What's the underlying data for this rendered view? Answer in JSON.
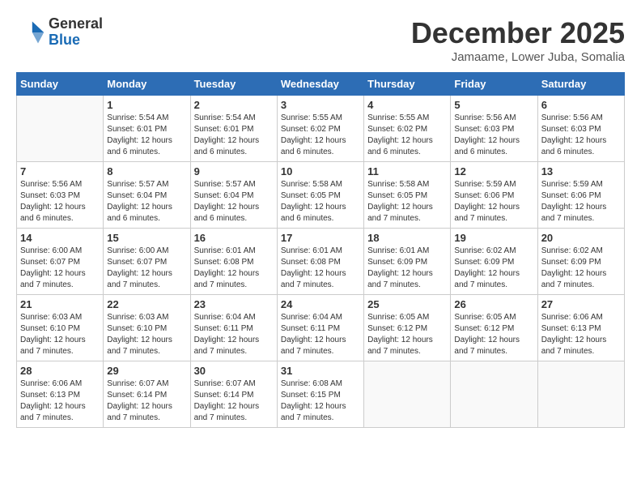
{
  "logo": {
    "line1": "General",
    "line2": "Blue"
  },
  "title": "December 2025",
  "subtitle": "Jamaame, Lower Juba, Somalia",
  "weekdays": [
    "Sunday",
    "Monday",
    "Tuesday",
    "Wednesday",
    "Thursday",
    "Friday",
    "Saturday"
  ],
  "weeks": [
    [
      {
        "day": null
      },
      {
        "day": "1",
        "sunrise": "5:54 AM",
        "sunset": "6:01 PM",
        "daylight": "12 hours and 6 minutes."
      },
      {
        "day": "2",
        "sunrise": "5:54 AM",
        "sunset": "6:01 PM",
        "daylight": "12 hours and 6 minutes."
      },
      {
        "day": "3",
        "sunrise": "5:55 AM",
        "sunset": "6:02 PM",
        "daylight": "12 hours and 6 minutes."
      },
      {
        "day": "4",
        "sunrise": "5:55 AM",
        "sunset": "6:02 PM",
        "daylight": "12 hours and 6 minutes."
      },
      {
        "day": "5",
        "sunrise": "5:56 AM",
        "sunset": "6:03 PM",
        "daylight": "12 hours and 6 minutes."
      },
      {
        "day": "6",
        "sunrise": "5:56 AM",
        "sunset": "6:03 PM",
        "daylight": "12 hours and 6 minutes."
      }
    ],
    [
      {
        "day": "7",
        "sunrise": "5:56 AM",
        "sunset": "6:03 PM",
        "daylight": "12 hours and 6 minutes."
      },
      {
        "day": "8",
        "sunrise": "5:57 AM",
        "sunset": "6:04 PM",
        "daylight": "12 hours and 6 minutes."
      },
      {
        "day": "9",
        "sunrise": "5:57 AM",
        "sunset": "6:04 PM",
        "daylight": "12 hours and 6 minutes."
      },
      {
        "day": "10",
        "sunrise": "5:58 AM",
        "sunset": "6:05 PM",
        "daylight": "12 hours and 6 minutes."
      },
      {
        "day": "11",
        "sunrise": "5:58 AM",
        "sunset": "6:05 PM",
        "daylight": "12 hours and 7 minutes."
      },
      {
        "day": "12",
        "sunrise": "5:59 AM",
        "sunset": "6:06 PM",
        "daylight": "12 hours and 7 minutes."
      },
      {
        "day": "13",
        "sunrise": "5:59 AM",
        "sunset": "6:06 PM",
        "daylight": "12 hours and 7 minutes."
      }
    ],
    [
      {
        "day": "14",
        "sunrise": "6:00 AM",
        "sunset": "6:07 PM",
        "daylight": "12 hours and 7 minutes."
      },
      {
        "day": "15",
        "sunrise": "6:00 AM",
        "sunset": "6:07 PM",
        "daylight": "12 hours and 7 minutes."
      },
      {
        "day": "16",
        "sunrise": "6:01 AM",
        "sunset": "6:08 PM",
        "daylight": "12 hours and 7 minutes."
      },
      {
        "day": "17",
        "sunrise": "6:01 AM",
        "sunset": "6:08 PM",
        "daylight": "12 hours and 7 minutes."
      },
      {
        "day": "18",
        "sunrise": "6:01 AM",
        "sunset": "6:09 PM",
        "daylight": "12 hours and 7 minutes."
      },
      {
        "day": "19",
        "sunrise": "6:02 AM",
        "sunset": "6:09 PM",
        "daylight": "12 hours and 7 minutes."
      },
      {
        "day": "20",
        "sunrise": "6:02 AM",
        "sunset": "6:09 PM",
        "daylight": "12 hours and 7 minutes."
      }
    ],
    [
      {
        "day": "21",
        "sunrise": "6:03 AM",
        "sunset": "6:10 PM",
        "daylight": "12 hours and 7 minutes."
      },
      {
        "day": "22",
        "sunrise": "6:03 AM",
        "sunset": "6:10 PM",
        "daylight": "12 hours and 7 minutes."
      },
      {
        "day": "23",
        "sunrise": "6:04 AM",
        "sunset": "6:11 PM",
        "daylight": "12 hours and 7 minutes."
      },
      {
        "day": "24",
        "sunrise": "6:04 AM",
        "sunset": "6:11 PM",
        "daylight": "12 hours and 7 minutes."
      },
      {
        "day": "25",
        "sunrise": "6:05 AM",
        "sunset": "6:12 PM",
        "daylight": "12 hours and 7 minutes."
      },
      {
        "day": "26",
        "sunrise": "6:05 AM",
        "sunset": "6:12 PM",
        "daylight": "12 hours and 7 minutes."
      },
      {
        "day": "27",
        "sunrise": "6:06 AM",
        "sunset": "6:13 PM",
        "daylight": "12 hours and 7 minutes."
      }
    ],
    [
      {
        "day": "28",
        "sunrise": "6:06 AM",
        "sunset": "6:13 PM",
        "daylight": "12 hours and 7 minutes."
      },
      {
        "day": "29",
        "sunrise": "6:07 AM",
        "sunset": "6:14 PM",
        "daylight": "12 hours and 7 minutes."
      },
      {
        "day": "30",
        "sunrise": "6:07 AM",
        "sunset": "6:14 PM",
        "daylight": "12 hours and 7 minutes."
      },
      {
        "day": "31",
        "sunrise": "6:08 AM",
        "sunset": "6:15 PM",
        "daylight": "12 hours and 7 minutes."
      },
      {
        "day": null
      },
      {
        "day": null
      },
      {
        "day": null
      }
    ]
  ]
}
